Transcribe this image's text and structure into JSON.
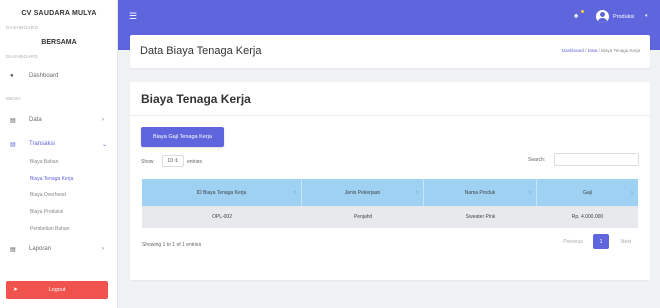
{
  "brand": {
    "line1": "CV SAUDARA MULYA",
    "line2": "BERSAMA"
  },
  "sidebar": {
    "section_dashboard": "DASHBOARD",
    "section_menu": "MENU",
    "dashboard": {
      "label": "Dashboard",
      "icon": "gauge-icon"
    },
    "data": {
      "label": "Data",
      "icon": "table-icon",
      "chevron": "›"
    },
    "transaksi": {
      "label": "Transaksi",
      "icon": "table-icon",
      "chevron": "⌄",
      "items": [
        {
          "label": "Biaya Bahan"
        },
        {
          "label": "Biaya Tenaga Kerja"
        },
        {
          "label": "Biaya Overhead"
        },
        {
          "label": "Biaya Produksi"
        },
        {
          "label": "Pembelian Bahan"
        }
      ]
    },
    "laporan": {
      "label": "Laporan",
      "icon": "table-icon",
      "chevron": "›"
    },
    "logout": {
      "label": "Logout",
      "icon": "logout-icon"
    }
  },
  "topbar": {
    "menu_icon": "☰",
    "bell_icon": "🔔",
    "user_name": "Produksi",
    "caret": "▾"
  },
  "header": {
    "title": "Data Biaya Tenaga Kerja",
    "breadcrumb": {
      "home": "Dashboard",
      "sep": "/",
      "data": "Data",
      "current": "Biaya Tenaga Kerja"
    }
  },
  "card": {
    "title": "Biaya Tenaga Kerja",
    "button_label": "Biaya Gaji Tenaga Kerja",
    "show_label": "Show",
    "show_value": "10 ⇕",
    "entries_label": "entries",
    "search_label": "Search:",
    "search_value": ""
  },
  "table": {
    "columns": [
      {
        "label": "ID Biaya Tenaga Kerja"
      },
      {
        "label": "Jenis Pekerjaan"
      },
      {
        "label": "Nama Produk"
      },
      {
        "label": "Gaji"
      }
    ],
    "rows": [
      [
        "OPL-002",
        "Penjahit",
        "Sweater Pink",
        "Rp. 4.000.000"
      ]
    ]
  },
  "pagination": {
    "info": "Showing 1 to 1 of 1 entries",
    "prev": "Previous",
    "page": "1",
    "next": "Next"
  },
  "colors": {
    "primary": "#5f66dd",
    "danger": "#f0534d",
    "table_header": "#9fd1f3"
  }
}
